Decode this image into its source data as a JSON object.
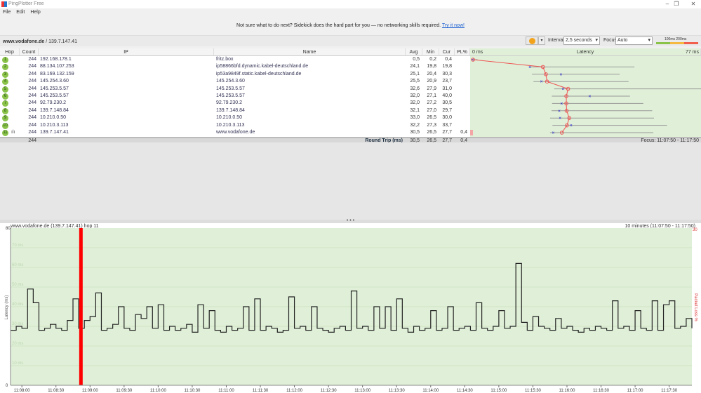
{
  "app": {
    "title": "PingPlotter Free",
    "menu": [
      "File",
      "Edit",
      "Help"
    ]
  },
  "banner": {
    "text": "Not sure what to do next? Sidekick does the hard part for you — no networking skills required.",
    "link": "Try it now!"
  },
  "target": {
    "host": "www.vodafone.de",
    "ip": "139.7.147.41"
  },
  "toolbar": {
    "pause_color": "#f2a31b",
    "interval_label": "Interval",
    "interval_value": "2,5 seconds",
    "focus_label": "Focus",
    "focus_value": "Auto",
    "scale": [
      "100ms",
      "200ms"
    ],
    "scale_colors": [
      "#8bc34a",
      "#f5b942",
      "#f0604d"
    ]
  },
  "columns": [
    "Hop",
    "Count",
    "IP",
    "Name",
    "Avg",
    "Min",
    "Cur",
    "PL%"
  ],
  "latency_header": {
    "label": "Latency",
    "min": "0 ms",
    "max": "77 ms"
  },
  "hops": [
    {
      "hop": "1",
      "count": "244",
      "ip": "192.168.178.1",
      "name": "fritz.box",
      "avg": "0,5",
      "min": "0,2",
      "cur": "0,4",
      "pl": "",
      "max": 2
    },
    {
      "hop": "2",
      "count": "244",
      "ip": "88.134.107.253",
      "name": "ip58866bfd.dynamic.kabel-deutschland.de",
      "avg": "24,1",
      "min": "19,8",
      "cur": "19,8",
      "pl": "",
      "max": 55
    },
    {
      "hop": "3",
      "count": "244",
      "ip": "83.169.132.159",
      "name": "ip53a9849f.static.kabel-deutschland.de",
      "avg": "25,1",
      "min": "20,4",
      "cur": "30,3",
      "pl": "",
      "max": 50
    },
    {
      "hop": "4",
      "count": "244",
      "ip": "145.254.3.60",
      "name": "145.254.3.60",
      "avg": "25,5",
      "min": "20,9",
      "cur": "23,7",
      "pl": "",
      "max": 53
    },
    {
      "hop": "5",
      "count": "244",
      "ip": "145.253.5.57",
      "name": "145.253.5.57",
      "avg": "32,6",
      "min": "27,9",
      "cur": "31,0",
      "pl": "",
      "max": 80
    },
    {
      "hop": "6",
      "count": "244",
      "ip": "145.253.5.57",
      "name": "145.253.5.57",
      "avg": "32,0",
      "min": "27,1",
      "cur": "40,0",
      "pl": "",
      "max": 53.5
    },
    {
      "hop": "7",
      "count": "244",
      "ip": "92.79.230.2",
      "name": "92.79.230.2",
      "avg": "32,0",
      "min": "27,2",
      "cur": "30,5",
      "pl": "",
      "max": 58
    },
    {
      "hop": "8",
      "count": "244",
      "ip": "139.7.148.84",
      "name": "139.7.148.84",
      "avg": "32,1",
      "min": "27,0",
      "cur": "29,7",
      "pl": "",
      "max": 61
    },
    {
      "hop": "9",
      "count": "244",
      "ip": "10.210.0.50",
      "name": "10.210.0.50",
      "avg": "33,0",
      "min": "26,5",
      "cur": "30,0",
      "pl": "",
      "max": 61.6
    },
    {
      "hop": "10",
      "count": "244",
      "ip": "10.210.3.113",
      "name": "10.210.3.113",
      "avg": "32,2",
      "min": "27,3",
      "cur": "33,7",
      "pl": "",
      "max": 66
    },
    {
      "hop": "11",
      "count": "244",
      "ip": "139.7.147.41",
      "name": "www.vodafone.de",
      "avg": "30,5",
      "min": "26,5",
      "cur": "27,7",
      "pl": "0,4",
      "max": 61.4
    }
  ],
  "summary": {
    "count": "244",
    "label": "Round Trip (ms)",
    "avg": "30,5",
    "min": "26,5",
    "cur": "27,7",
    "pl": "0,4",
    "focus": "Focus: 11:07:50 - 11:17:50"
  },
  "chart_data": {
    "type": "line",
    "title": "www.vodafone.de (139.7.147.41) hop 11",
    "range_label": "10 minutes (11:07:50 - 11:17:50)",
    "ylabel": "Latency (ms)",
    "y2label": "Packet Loss %",
    "ylim": [
      0,
      80
    ],
    "y2max": "30",
    "y_ticks": [
      "0",
      "10 ms",
      "20 ms",
      "30 ms",
      "40 ms",
      "50 ms",
      "60 ms",
      "70 ms",
      "80"
    ],
    "x_ticks": [
      "11:08:00",
      "11:08:30",
      "11:09:00",
      "11:09:30",
      "11:10:00",
      "11:10:30",
      "11:11:00",
      "11:11:30",
      "11:12:00",
      "11:12:30",
      "11:13:00",
      "11:13:30",
      "11:14:00",
      "11:14:30",
      "11:15:00",
      "11:15:30",
      "11:16:00",
      "11:16:30",
      "11:17:00",
      "11:17:30"
    ],
    "x_start": "11:07:50",
    "x_end": "11:17:50",
    "sample_interval_s": 5,
    "latency": [
      28,
      30,
      29,
      49,
      42,
      28,
      29,
      31,
      29,
      28,
      33,
      44,
      29,
      33,
      35,
      47,
      28,
      29,
      31,
      40,
      29,
      28,
      36,
      34,
      40,
      29,
      41,
      28,
      30,
      28,
      29,
      31,
      27,
      41,
      29,
      38,
      28,
      27,
      30,
      28,
      29,
      40,
      28,
      44,
      28,
      30,
      29,
      27,
      28,
      45,
      29,
      30,
      28,
      40,
      29,
      28,
      27,
      29,
      30,
      28,
      48,
      29,
      30,
      28,
      40,
      29,
      40,
      28,
      44,
      29,
      27,
      30,
      28,
      29,
      38,
      28,
      29,
      40,
      28,
      29,
      30,
      28,
      42,
      29,
      28,
      30,
      38,
      29,
      30,
      62,
      32,
      28,
      35,
      30,
      29,
      28,
      34,
      29,
      30,
      28,
      27,
      29,
      28,
      30,
      29,
      28,
      43,
      29,
      30,
      28,
      38,
      29,
      28,
      43,
      28,
      41,
      43,
      29,
      30,
      34,
      29
    ],
    "packet_loss_events": [
      "11:08:52"
    ],
    "loss_color": "#ff0000",
    "background_color": "#e0f0d8"
  }
}
